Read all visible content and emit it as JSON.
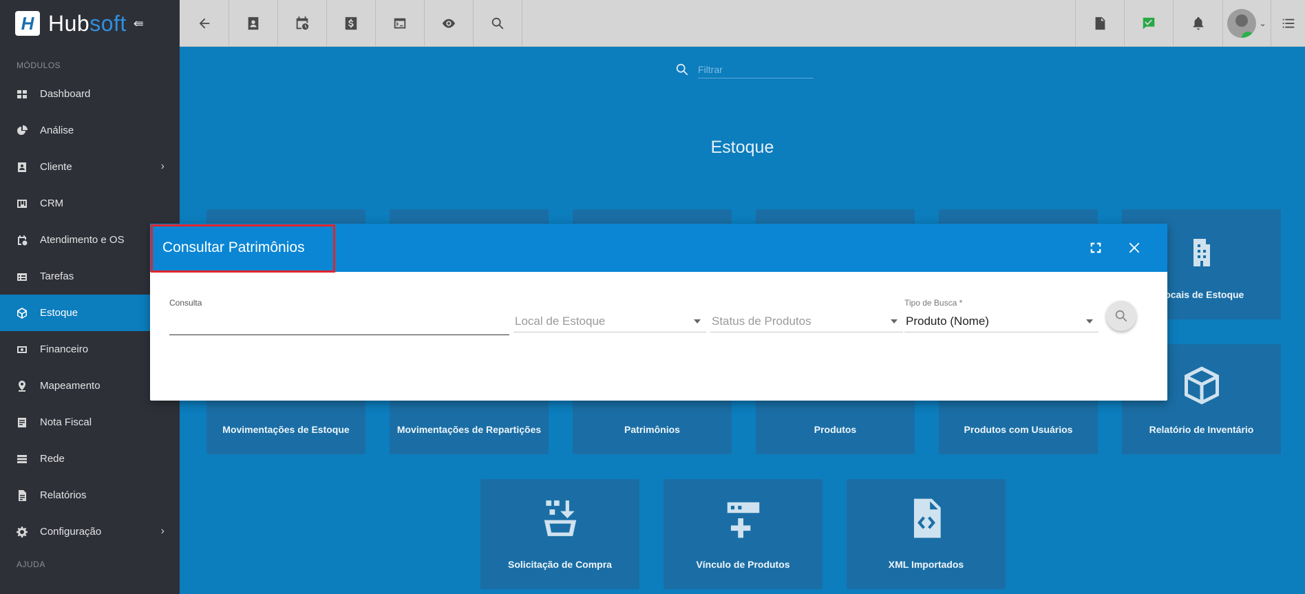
{
  "brand": {
    "logo_letter": "H",
    "name_hub": "Hub",
    "name_soft": "soft"
  },
  "sidebar": {
    "section_modules": "MÓDULOS",
    "items": [
      {
        "label": "Dashboard",
        "icon": "dashboard-icon"
      },
      {
        "label": "Análise",
        "icon": "pie-chart-icon"
      },
      {
        "label": "Cliente",
        "icon": "contact-card-icon",
        "has_children": true
      },
      {
        "label": "CRM",
        "icon": "kanban-icon"
      },
      {
        "label": "Atendimento e OS",
        "icon": "calendar-clock-icon"
      },
      {
        "label": "Tarefas",
        "icon": "tasks-icon"
      },
      {
        "label": "Estoque",
        "icon": "box-icon",
        "active": true
      },
      {
        "label": "Financeiro",
        "icon": "money-icon"
      },
      {
        "label": "Mapeamento",
        "icon": "map-pin-icon"
      },
      {
        "label": "Nota Fiscal",
        "icon": "invoice-icon"
      },
      {
        "label": "Rede",
        "icon": "server-icon"
      },
      {
        "label": "Relatórios",
        "icon": "report-icon"
      },
      {
        "label": "Configuração",
        "icon": "gear-icon",
        "has_children": true
      }
    ],
    "section_help": "AJUDA"
  },
  "topbar": {
    "left_icons": [
      "back-arrow-icon",
      "contact-card-icon",
      "calendar-clock-icon",
      "dollar-icon",
      "terminal-icon",
      "eye-icon",
      "search-icon"
    ],
    "right_icons": [
      "pdf-icon",
      "chat-check-icon",
      "bell-icon"
    ]
  },
  "main": {
    "filter_placeholder": "Filtrar",
    "title": "Estoque",
    "tiles_row2": [
      {
        "label": "Movimentações de Estoque"
      },
      {
        "label": "Movimentações de Repartições"
      },
      {
        "label": "Patrimônios"
      },
      {
        "label": "Produtos"
      },
      {
        "label": "Produtos com Usuários"
      },
      {
        "label": "Relatório de Inventário",
        "icon": "cube-icon"
      }
    ],
    "tile_row1_last": {
      "label": "Locais de Estoque",
      "icon": "building-icon"
    },
    "tiles_row3": [
      {
        "label": "Solicitação de Compra",
        "icon": "basket-download-icon"
      },
      {
        "label": "Vínculo de Produtos",
        "icon": "server-add-icon"
      },
      {
        "label": "XML Importados",
        "icon": "code-file-icon"
      }
    ]
  },
  "modal": {
    "title": "Consultar Patrimônios",
    "fields": {
      "consulta_label": "Consulta",
      "consulta_value": "",
      "local_placeholder": "Local de Estoque",
      "status_placeholder": "Status de Produtos",
      "tipo_label": "Tipo de Busca *",
      "tipo_value": "Produto (Nome)"
    }
  }
}
